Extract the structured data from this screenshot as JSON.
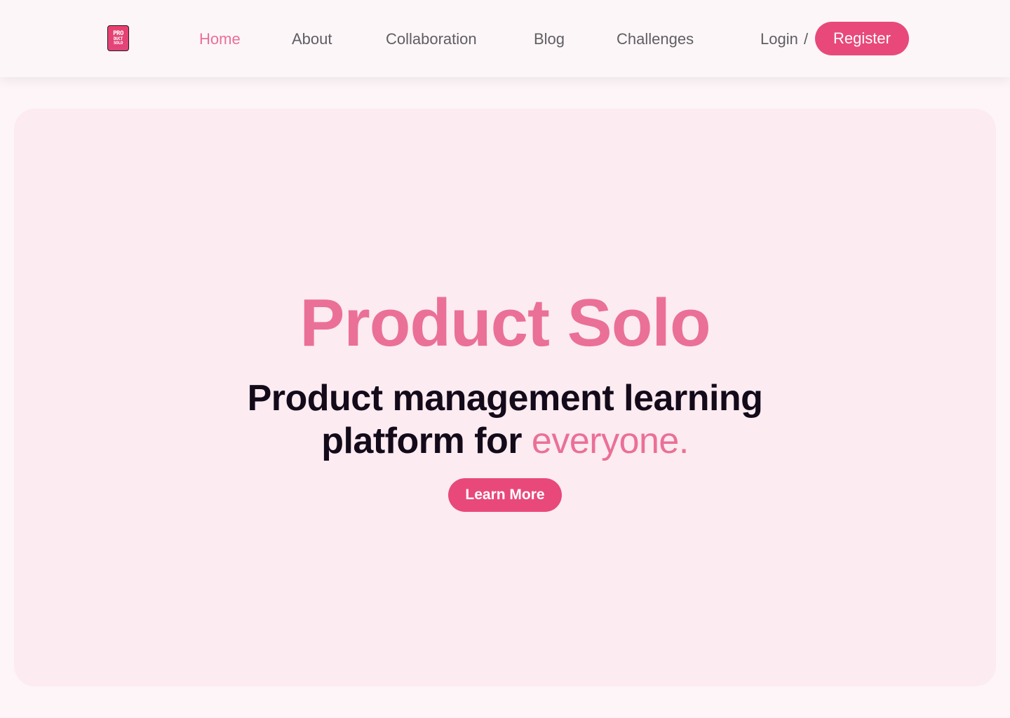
{
  "brand": {
    "logo_lines": [
      "PRO",
      "DUCT",
      "SOLO"
    ],
    "accent_color": "#e8497a",
    "highlight_color": "#ea7097"
  },
  "nav": {
    "items": [
      {
        "label": "Home",
        "active": true
      },
      {
        "label": "About",
        "active": false
      },
      {
        "label": "Collaboration",
        "active": false
      },
      {
        "label": "Blog",
        "active": false
      },
      {
        "label": "Challenges",
        "active": false
      }
    ],
    "login_label": "Login",
    "separator": "/",
    "register_label": "Register"
  },
  "hero": {
    "title": "Product Solo",
    "subtitle_line1": "Product management learning",
    "subtitle_line2_prefix": "platform for ",
    "subtitle_line2_accent": "everyone.",
    "cta_label": "Learn More"
  }
}
